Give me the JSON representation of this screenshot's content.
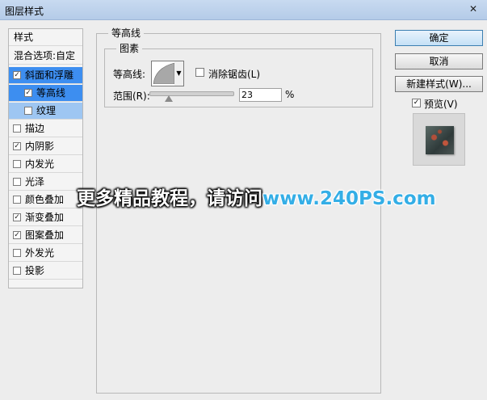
{
  "window": {
    "title": "图层样式",
    "close_glyph": "✕"
  },
  "left_panel": {
    "header": "样式",
    "blend_options": "混合选项:自定",
    "items": [
      {
        "label": "斜面和浮雕",
        "checked": true,
        "selected": true
      },
      {
        "label": "等高线",
        "checked": true,
        "selected": true,
        "sub": true
      },
      {
        "label": "纹理",
        "checked": false,
        "sub": true
      },
      {
        "label": "描边",
        "checked": false
      },
      {
        "label": "内阴影",
        "checked": true
      },
      {
        "label": "内发光",
        "checked": false
      },
      {
        "label": "光泽",
        "checked": false
      },
      {
        "label": "颜色叠加",
        "checked": false
      },
      {
        "label": "渐变叠加",
        "checked": true
      },
      {
        "label": "图案叠加",
        "checked": true
      },
      {
        "label": "外发光",
        "checked": false
      },
      {
        "label": "投影",
        "checked": false
      }
    ],
    "check_glyph": "✓"
  },
  "center": {
    "section_title": "等高线",
    "group_title": "图素",
    "contour_label": "等高线:",
    "dropdown_glyph": "▼",
    "antialias_label": "消除锯齿(L)",
    "range_label": "范围(R):",
    "range_value": "23",
    "range_unit": "%",
    "range_fraction": 0.23
  },
  "right": {
    "ok": "确定",
    "cancel": "取消",
    "new_style": "新建样式(W)...",
    "preview_label": "预览(V)",
    "preview_checked": true
  },
  "watermark": {
    "cn": "更多精品教程，请访问",
    "url": "www.240PS.com"
  }
}
